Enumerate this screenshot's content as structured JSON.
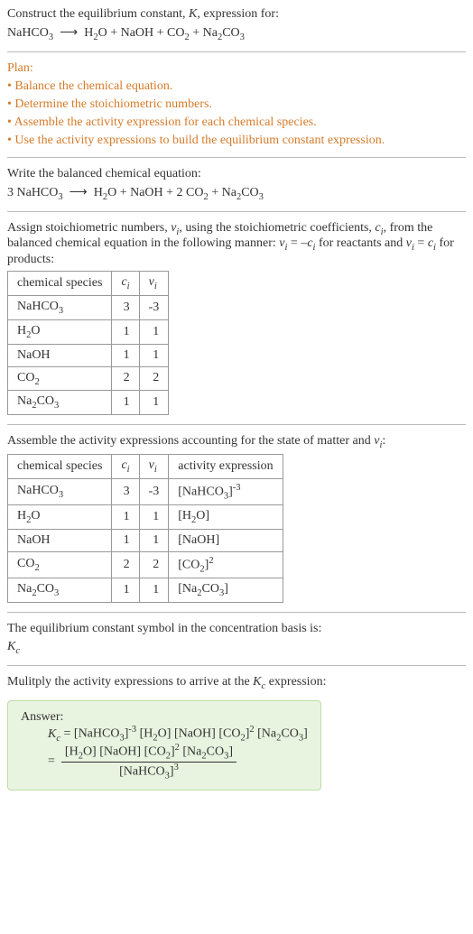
{
  "intro": {
    "line1": "Construct the equilibrium constant, K, expression for:",
    "equation": "NaHCO₃ ⟶ H₂O + NaOH + CO₂ + Na₂CO₃"
  },
  "plan": {
    "heading": "Plan:",
    "items": [
      "Balance the chemical equation.",
      "Determine the stoichiometric numbers.",
      "Assemble the activity expression for each chemical species.",
      "Use the activity expressions to build the equilibrium constant expression."
    ]
  },
  "balanced": {
    "heading": "Write the balanced chemical equation:",
    "equation": "3 NaHCO₃ ⟶ H₂O + NaOH + 2 CO₂ + Na₂CO₃"
  },
  "assign": {
    "text_a": "Assign stoichiometric numbers, νᵢ, using the stoichiometric coefficients, cᵢ, from the balanced chemical equation in the following manner: νᵢ = –cᵢ for reactants and νᵢ = cᵢ for products:",
    "table": {
      "headers": [
        "chemical species",
        "cᵢ",
        "νᵢ"
      ],
      "rows": [
        [
          "NaHCO₃",
          "3",
          "-3"
        ],
        [
          "H₂O",
          "1",
          "1"
        ],
        [
          "NaOH",
          "1",
          "1"
        ],
        [
          "CO₂",
          "2",
          "2"
        ],
        [
          "Na₂CO₃",
          "1",
          "1"
        ]
      ]
    }
  },
  "activity": {
    "heading": "Assemble the activity expressions accounting for the state of matter and νᵢ:",
    "table": {
      "headers": [
        "chemical species",
        "cᵢ",
        "νᵢ",
        "activity expression"
      ],
      "rows": [
        [
          "NaHCO₃",
          "3",
          "-3",
          "[NaHCO₃]⁻³"
        ],
        [
          "H₂O",
          "1",
          "1",
          "[H₂O]"
        ],
        [
          "NaOH",
          "1",
          "1",
          "[NaOH]"
        ],
        [
          "CO₂",
          "2",
          "2",
          "[CO₂]²"
        ],
        [
          "Na₂CO₃",
          "1",
          "1",
          "[Na₂CO₃]"
        ]
      ]
    }
  },
  "symbol": {
    "line1": "The equilibrium constant symbol in the concentration basis is:",
    "line2": "K_c"
  },
  "multiply": {
    "heading": "Mulitply the activity expressions to arrive at the K_c expression:"
  },
  "answer": {
    "label": "Answer:",
    "line1_lhs": "K_c = ",
    "line1_rhs": "[NaHCO₃]⁻³ [H₂O] [NaOH] [CO₂]² [Na₂CO₃]",
    "frac_num": "[H₂O] [NaOH] [CO₂]² [Na₂CO₃]",
    "frac_den": "[NaHCO₃]³",
    "eq_sign": "="
  }
}
